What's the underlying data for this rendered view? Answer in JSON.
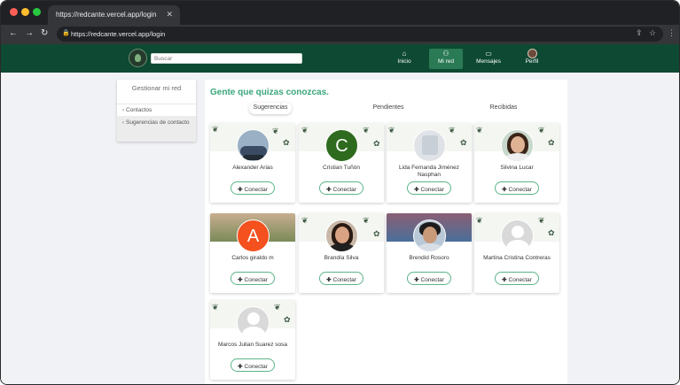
{
  "browser": {
    "tab_title": "https://redcante.vercel.app/login",
    "url": "https://redcante.vercel.app/login"
  },
  "header": {
    "search_placeholder": "Buscar",
    "nav": [
      {
        "label": "Inicio",
        "icon": "home-icon"
      },
      {
        "label": "Mi red",
        "icon": "network-icon"
      },
      {
        "label": "Mensajes",
        "icon": "message-icon"
      },
      {
        "label": "Perfil",
        "icon": "avatar"
      }
    ]
  },
  "sidebar": {
    "title": "Gestionar mi red",
    "items": [
      "Contactos",
      "Sugerencias de contacto"
    ]
  },
  "main": {
    "title": "Gente que quizas conozcas.",
    "tabs": [
      "Sugerencias",
      "Pendientes",
      "Recibidas"
    ],
    "connect_label": "Conectar"
  },
  "people": [
    {
      "name": "Alexander Arias"
    },
    {
      "name": "Cristian Tuñón"
    },
    {
      "name": "Lida Fernanda Jiménez Nasphan"
    },
    {
      "name": "Silvina Lucar"
    },
    {
      "name": "Carlos giraldo m"
    },
    {
      "name": "Brandía Silva"
    },
    {
      "name": "Brendid Rosoro"
    },
    {
      "name": "Martina Cristina Contreras"
    },
    {
      "name": "Marcos Julian Suarez sosa"
    }
  ],
  "colors": {
    "header_bg": "#0e4a33",
    "accent": "#3aa77a",
    "button_border": "#5cb48a"
  }
}
